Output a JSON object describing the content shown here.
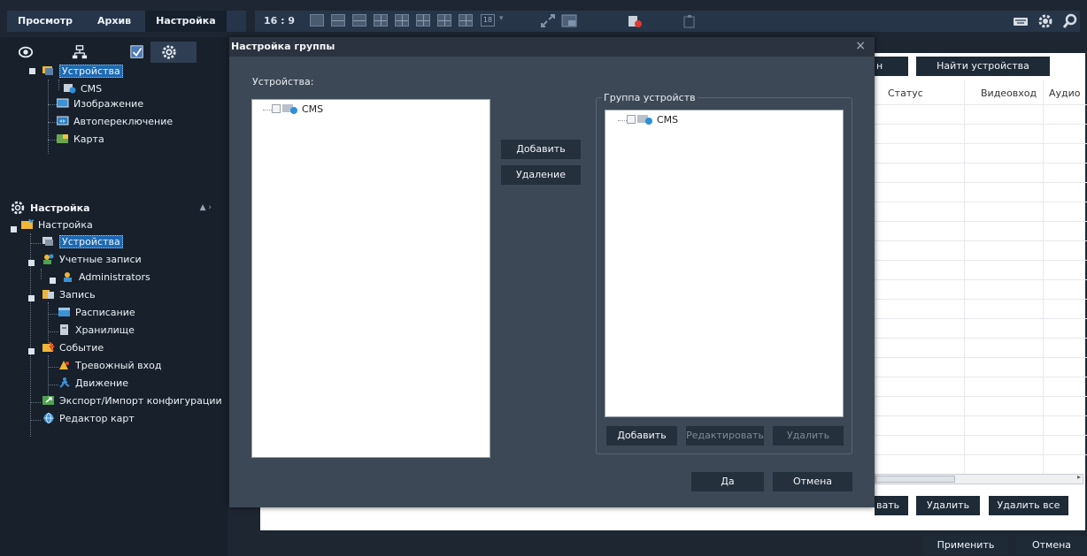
{
  "top_tabs": [
    "Просмотр",
    "Архив",
    "Настройка"
  ],
  "toolbar": {
    "ratio": "16 : 9",
    "layout_count": "18"
  },
  "left": {
    "tree1": {
      "devices": "Устройства",
      "cms": "CMS",
      "image": "Изображение",
      "autoswitch": "Автопереключение",
      "map": "Карта"
    },
    "settings_header": "Настройка",
    "tree2": {
      "root": "Настройка",
      "devices": "Устройства",
      "accounts": "Учетные записи",
      "admins": "Administrators",
      "record": "Запись",
      "schedule": "Расписание",
      "storage": "Хранилище",
      "event": "Событие",
      "alarm": "Тревожный вход",
      "motion": "Движение",
      "export": "Экспорт/Импорт конфигурации",
      "mapeditor": "Редактор карт"
    }
  },
  "main": {
    "btn_partial": "н",
    "find_devices": "Найти устройства",
    "columns": [
      "Статус",
      "Видеовход",
      "Аудио"
    ],
    "edit_partial": "вать",
    "delete": "Удалить",
    "delete_all": "Удалить все",
    "apply": "Применить",
    "cancel": "Отмена"
  },
  "dialog": {
    "title": "Настройка группы",
    "devices_label": "Устройства:",
    "left_item": "CMS",
    "add": "Добавить",
    "remove": "Удаление",
    "group_label": "Группа устройств",
    "group_item": "CMS",
    "grp_add": "Добавить",
    "grp_edit": "Редактировать",
    "grp_delete": "Удалить",
    "ok": "Да",
    "cancel": "Отмена"
  }
}
